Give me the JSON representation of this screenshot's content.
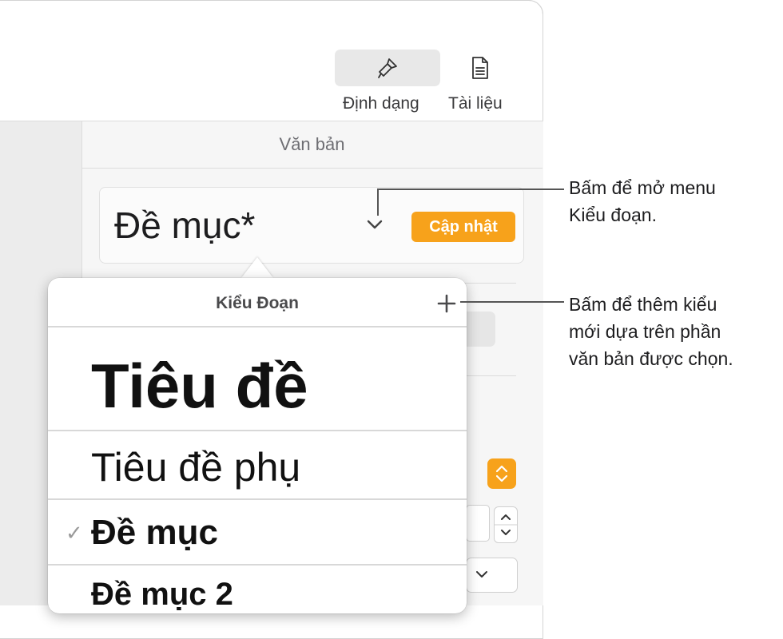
{
  "toolbar": {
    "format_label": "Định dạng",
    "document_label": "Tài liệu",
    "format_icon": "paintbrush-icon",
    "document_icon": "document-icon"
  },
  "inspector": {
    "section_title": "Văn bản",
    "paragraph_style": "Đề mục*",
    "update_button": "Cập nhật"
  },
  "popover": {
    "title": "Kiểu Đoạn",
    "add_icon": "plus-icon",
    "styles": [
      {
        "label": "Tiêu đề",
        "selected": false
      },
      {
        "label": "Tiêu đề phụ",
        "selected": false
      },
      {
        "label": "Đề mục",
        "selected": true
      },
      {
        "label": "Đề mục 2",
        "selected": false
      }
    ],
    "check_glyph": "✓"
  },
  "callouts": {
    "menu": [
      "Bấm để mở menu",
      "Kiểu đoạn."
    ],
    "add": [
      "Bấm để thêm kiểu",
      "mới dựa trên phần",
      "văn bản được chọn."
    ]
  },
  "colors": {
    "accent": "#f7a21b",
    "update_text": "#ffffff"
  }
}
